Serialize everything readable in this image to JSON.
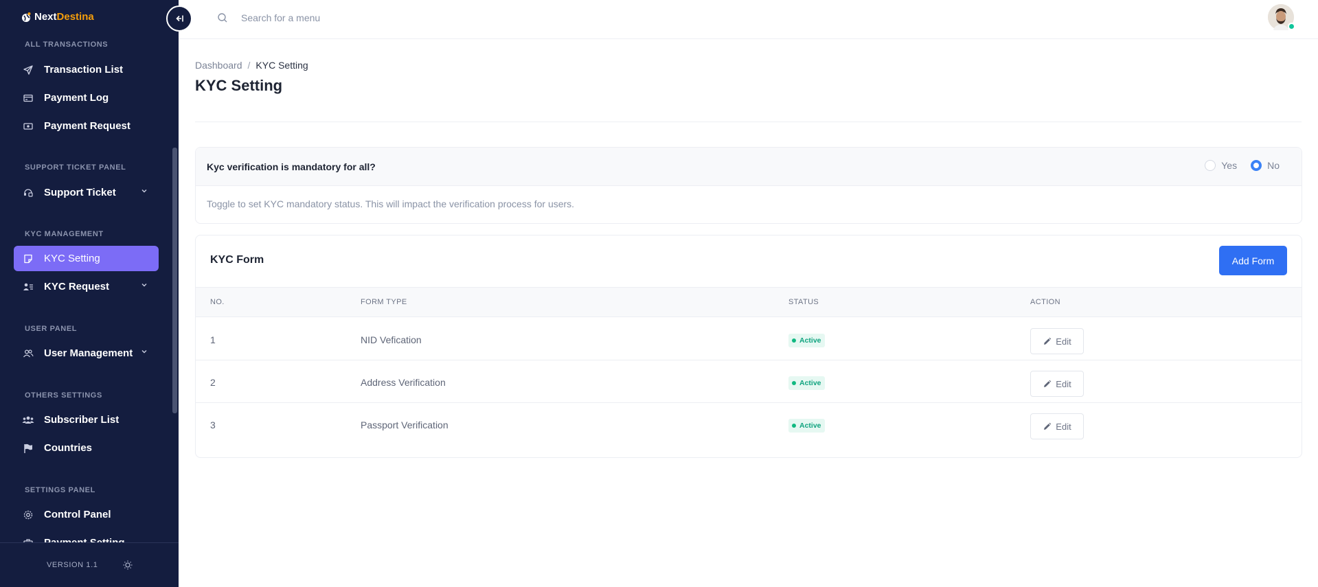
{
  "brand": {
    "name_part1": "Next",
    "name_part2": "Destina"
  },
  "search": {
    "placeholder": "Search for a menu"
  },
  "sidebar": {
    "sections": [
      {
        "title": "ALL TRANSACTIONS",
        "items": [
          {
            "label": "Transaction List",
            "icon": "send-icon"
          },
          {
            "label": "Payment Log",
            "icon": "card-icon"
          },
          {
            "label": "Payment Request",
            "icon": "cash-icon"
          }
        ]
      },
      {
        "title": "SUPPORT TICKET PANEL",
        "items": [
          {
            "label": "Support Ticket",
            "icon": "ticket-icon",
            "expandable": true
          }
        ]
      },
      {
        "title": "KYC MANAGEMENT",
        "items": [
          {
            "label": "KYC Setting",
            "icon": "note-icon",
            "active": true
          },
          {
            "label": "KYC Request",
            "icon": "user-list-icon",
            "expandable": true
          }
        ]
      },
      {
        "title": "USER PANEL",
        "items": [
          {
            "label": "User Management",
            "icon": "users-icon",
            "expandable": true
          }
        ]
      },
      {
        "title": "OTHERS SETTINGS",
        "items": [
          {
            "label": "Subscriber List",
            "icon": "group-icon"
          },
          {
            "label": "Countries",
            "icon": "flag-icon"
          }
        ]
      },
      {
        "title": "SETTINGS PANEL",
        "items": [
          {
            "label": "Control Panel",
            "icon": "gear-icon"
          },
          {
            "label": "Payment Setting",
            "icon": "briefcase-icon"
          }
        ]
      }
    ],
    "version": "VERSION 1.1"
  },
  "breadcrumb": {
    "home": "Dashboard",
    "separator": "/",
    "current": "KYC Setting"
  },
  "page_title": "KYC Setting",
  "kyc_mandatory": {
    "question": "Kyc verification is mandatory for all?",
    "options": [
      "Yes",
      "No"
    ],
    "selected": "No",
    "hint": "Toggle to set KYC mandatory status. This will impact the verification process for users."
  },
  "kyc_form": {
    "title": "KYC Form",
    "add_button": "Add Form",
    "columns": [
      "NO.",
      "FORM TYPE",
      "STATUS",
      "ACTION"
    ],
    "rows": [
      {
        "no": "1",
        "form_type": "NID Vefication",
        "status": "Active",
        "action": "Edit"
      },
      {
        "no": "2",
        "form_type": "Address Verification",
        "status": "Active",
        "action": "Edit"
      },
      {
        "no": "3",
        "form_type": "Passport Verification",
        "status": "Active",
        "action": "Edit"
      }
    ]
  },
  "colors": {
    "sidebar_bg": "#141d3f",
    "active_item": "#7c6cf6",
    "primary": "#2f6ff3",
    "success": "#10b981"
  }
}
